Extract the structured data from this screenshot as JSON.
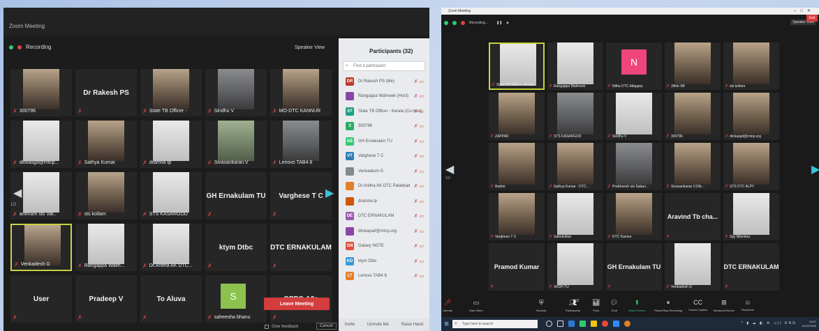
{
  "left": {
    "window_title": "Zoom Meeting",
    "recording": "Recording",
    "speaker_view": "Speaker View",
    "page_indicator": "1/2",
    "tiles": [
      {
        "name": "300796",
        "big": ""
      },
      {
        "name": "",
        "big": "Dr Rakesh PS"
      },
      {
        "name": "State TB Officer -",
        "big": ""
      },
      {
        "name": "Sindhu V",
        "big": ""
      },
      {
        "name": "MO-DTC KANNUR",
        "big": ""
      },
      {
        "name": "dtckasgd@rntcp...",
        "big": ""
      },
      {
        "name": "Sathya Kumar",
        "big": ""
      },
      {
        "name": "dramna tp",
        "big": ""
      },
      {
        "name": "Sivasankaran.V",
        "big": ""
      },
      {
        "name": "Lenovo TAB4 8",
        "big": ""
      },
      {
        "name": "anthram sts Vat..",
        "big": ""
      },
      {
        "name": "sts kollam",
        "big": ""
      },
      {
        "name": "STS KASARGOD",
        "big": ""
      },
      {
        "name": "",
        "big": "GH Ernakulam TU"
      },
      {
        "name": "",
        "big": "Varghese T C"
      },
      {
        "name": "Venkadesh G",
        "big": ""
      },
      {
        "name": "Rangappa Walm...",
        "big": ""
      },
      {
        "name": "Dr.Anitha AK DTC...",
        "big": ""
      },
      {
        "name": "",
        "big": "ktym Dtbc"
      },
      {
        "name": "",
        "big": "DTC ERNAKULAM"
      },
      {
        "name": "",
        "big": "User"
      },
      {
        "name": "",
        "big": "Pradeep V"
      },
      {
        "name": "",
        "big": "To Aluva"
      },
      {
        "name": "saheesha bhanu",
        "big": ""
      },
      {
        "name": "",
        "big": "OPPO A3s"
      }
    ],
    "participants": {
      "title": "Participants (32)",
      "search_placeholder": "Find a participant",
      "rows": [
        {
          "initials": "DR",
          "name": "Dr Rakesh PS (Me)",
          "color": "#c0392b"
        },
        {
          "initials": "",
          "name": "Rangappa Walmeek (Host)",
          "color": "#8e44ad"
        },
        {
          "initials": "ST",
          "name": "State TB Officer - Kerala (Co-host)",
          "color": "#16a085"
        },
        {
          "initials": "3",
          "name": "300796",
          "color": "#27ae60"
        },
        {
          "initials": "GE",
          "name": "GH Ernakulam TU",
          "color": "#2ecc71"
        },
        {
          "initials": "VT",
          "name": "Varghese T C",
          "color": "#2980b9"
        },
        {
          "initials": "",
          "name": "Venkadesh G",
          "color": "#7f8c8d"
        },
        {
          "initials": "",
          "name": "Dr.Anitha AK DTC Palakkad",
          "color": "#e67e22"
        },
        {
          "initials": "",
          "name": "dramna tp",
          "color": "#d35400"
        },
        {
          "initials": "DE",
          "name": "DTC ERNAKULAM",
          "color": "#9b59b6"
        },
        {
          "initials": "",
          "name": "dtcwayad@rntcp.org",
          "color": "#8e44ad"
        },
        {
          "initials": "GN",
          "name": "Galaxy NOTE",
          "color": "#e74c3c"
        },
        {
          "initials": "KD",
          "name": "ktym Dtbc",
          "color": "#3498db"
        },
        {
          "initials": "LT",
          "name": "Lenovo TAB4 8",
          "color": "#e67e22"
        }
      ],
      "footer": [
        "Invite",
        "Unmute Me",
        "Raise Hand"
      ]
    },
    "leave_meeting": "Leave Meeting",
    "give_feedback": "Give feedback",
    "cancel": "Cancel"
  },
  "right": {
    "window_title": "Zoom Meeting",
    "recording": "Recording...",
    "speaker_view": "Speaker View",
    "page_indicator": "1/2",
    "tiles": [
      {
        "name": "State TB Officer - Kerala",
        "big": ""
      },
      {
        "name": "Rangappa Walmeek",
        "big": ""
      },
      {
        "name": "Nithu DTC Allappey",
        "big": ""
      },
      {
        "name": "Jithin SB",
        "big": ""
      },
      {
        "name": "sts kollam",
        "big": ""
      },
      {
        "name": "ZAPPAD",
        "big": ""
      },
      {
        "name": "STS KASARGOD",
        "big": ""
      },
      {
        "name": "Sindhu V",
        "big": ""
      },
      {
        "name": "300796",
        "big": ""
      },
      {
        "name": "dtckasgd@rntcp.org",
        "big": ""
      },
      {
        "name": "Redmi",
        "big": ""
      },
      {
        "name": "Sathya Kumar - DTC...",
        "big": ""
      },
      {
        "name": "Prabheesh sts Sabari...",
        "big": ""
      },
      {
        "name": "Sivasankaran.V.Dtb...",
        "big": ""
      },
      {
        "name": "STS DTC ALPY",
        "big": ""
      },
      {
        "name": "Varghese T C",
        "big": ""
      },
      {
        "name": "Sabukuttan",
        "big": ""
      },
      {
        "name": "DTC Kannur",
        "big": ""
      },
      {
        "name": "",
        "big": "Aravind Tb cha..."
      },
      {
        "name": "Sijy Nilambur",
        "big": ""
      },
      {
        "name": "",
        "big": "Pramod Kumar"
      },
      {
        "name": "SKDH TU",
        "big": ""
      },
      {
        "name": "",
        "big": "GH Ernakulam TU"
      },
      {
        "name": "Venkadesh G",
        "big": ""
      },
      {
        "name": "",
        "big": "DTC ERNAKULAM"
      }
    ],
    "toolbar": [
      "Unmute",
      "Start Video",
      "Security",
      "Participants",
      "Polls",
      "Chat",
      "Share Screen",
      "Pause/Stop Recording",
      "Closed Caption",
      "Breakout Rooms",
      "Reactions"
    ],
    "participant_count": "32",
    "end": "End",
    "taskbar_search": "Type here to search",
    "time": "19:07",
    "date": "24-09-2020"
  }
}
